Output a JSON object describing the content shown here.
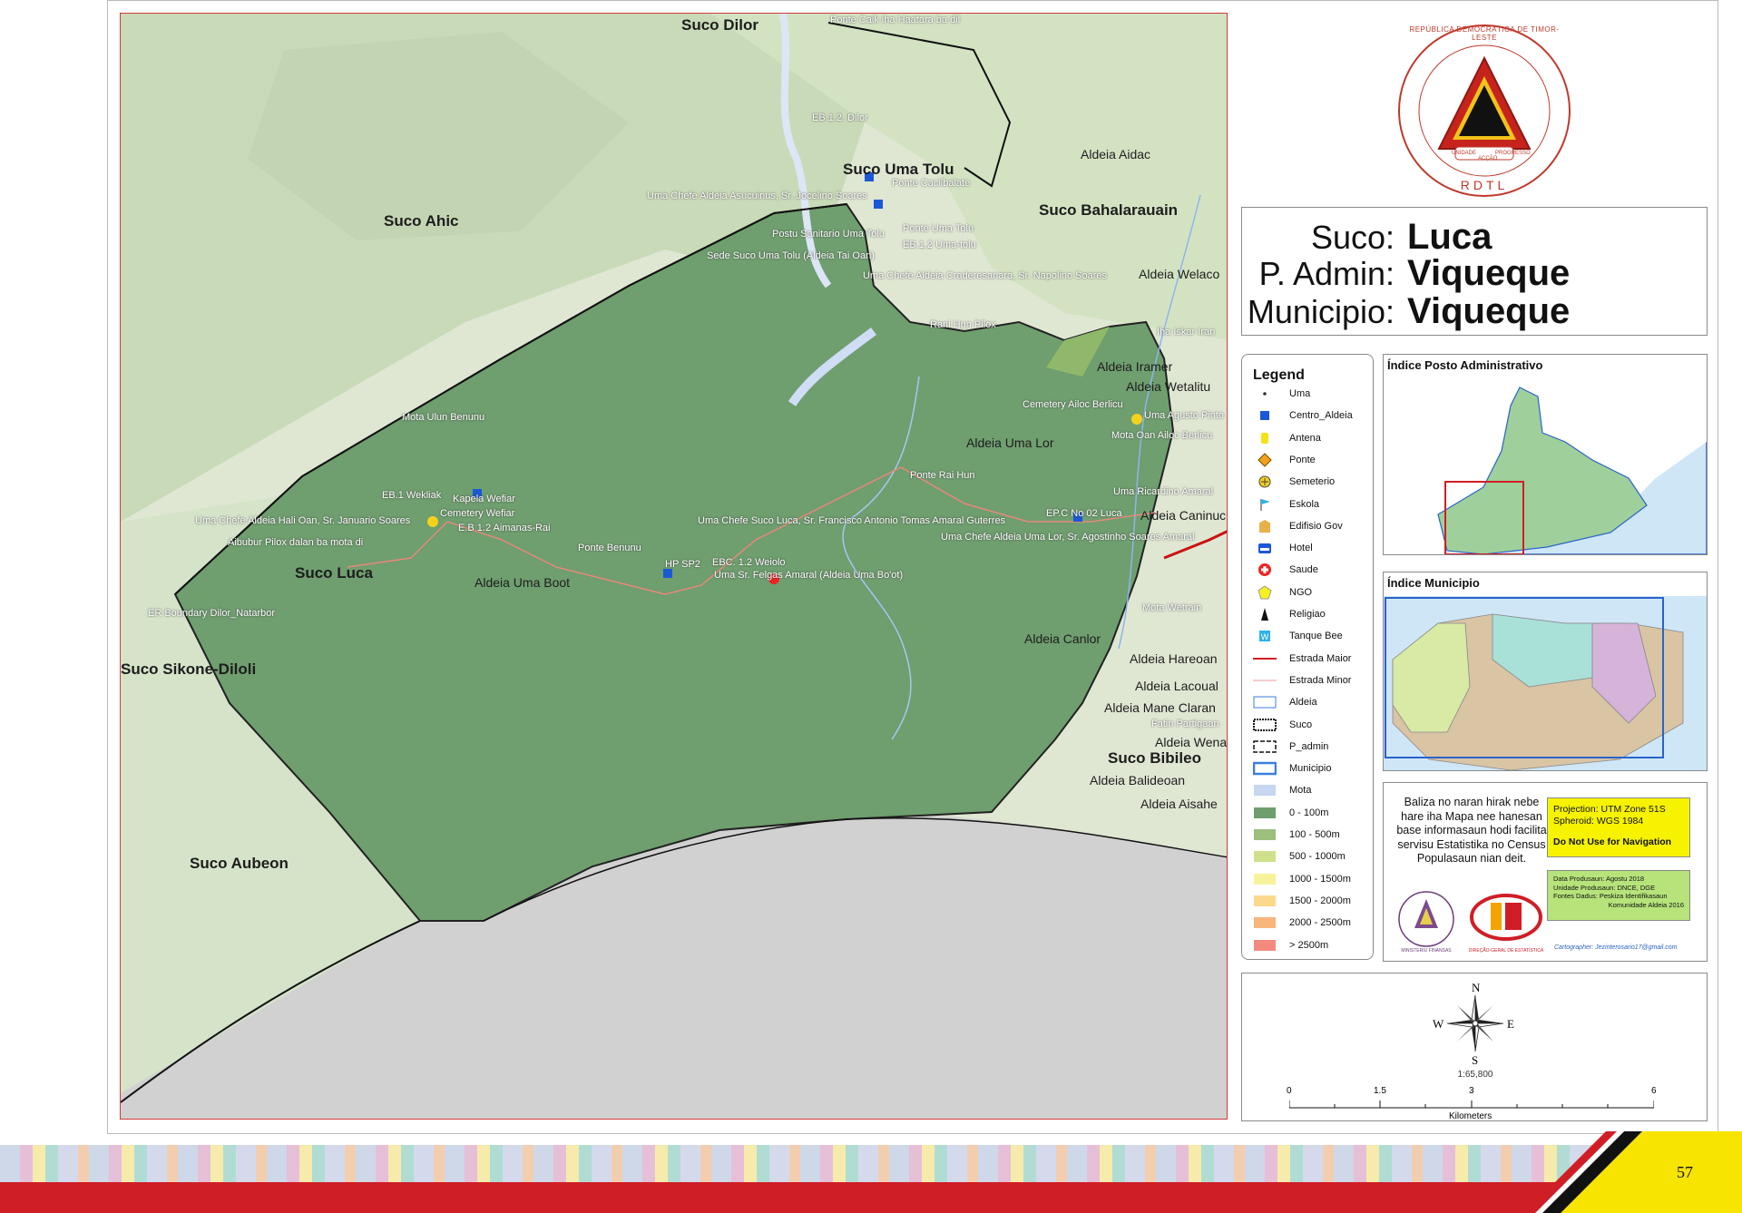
{
  "map": {
    "suco_labels": [
      "Suco Dilor",
      "Suco Uma Tolu",
      "Suco Ahic",
      "Suco Bahalarauain",
      "Suco Luca",
      "Suco Sikone-Diloli",
      "Suco Aubeon",
      "Suco Bibileo"
    ],
    "aldeia_labels": [
      "Aldeia Aidac",
      "Aldeia Welaco",
      "Aldeia Iramer",
      "Aldeia Wetalitu",
      "Aldeia Uma Lor",
      "Aldeia Uma Boot",
      "Aldeia Caninuc",
      "Aldeia Canlor",
      "Aldeia Hareoan",
      "Aldeia Lacoual",
      "Aldeia Mane Claran",
      "Aldeia Wenan",
      "Aldeia Balideoan",
      "Aldeia Aisahe"
    ],
    "feature_labels": [
      "Ponte Caik iha Haatara ba dil",
      "EB.1.2. Dilor",
      "Ponte Cacilbalate",
      "Uma Chefe Aldeia Asucuinus, Sr. Jocelino Soares",
      "Ponte Uma Tolu",
      "Postu Sanitario Uma Tolu",
      "EB.1.2 Uma-tolu",
      "Sede Suco Uma Tolu (Aldeia Tai Oan)",
      "Uma Chefe Aldeia Craderesanara, Sr. Napolino Soares",
      "Rani Hun Pilox",
      "Iha Iskar Iran",
      "Mota Ulun Benunu",
      "Cemetery Ailoc Berlicu",
      "Uma Agusto Pinto",
      "Mota Oan Ailoc Berlicu",
      "Ponte Rai Hun",
      "EB.1 Wekliak",
      "Kapela Wefiar",
      "Cemetery Wefiar",
      "Uma Chefe Aldeia Hali Oan, Sr. Januario Soares",
      "E.B 1.2 Aimanas-Rai",
      "Aibubur Pilox dalan ba mota di",
      "Uma Chefe Suco Luca, Sr. Francisco Antonio Tomas Amaral Guterres",
      "EP.C No 02 Luca",
      "Uma Ricardino Amaral",
      "Uma Chefe Aldeia Uma Lor, Sr. Agostinho Soares Amaral",
      "Ponte Benunu",
      "HP SP2",
      "EBC. 1.2 Weiolo",
      "Uma Sr. Felgas Amaral (Aldeia Uma Bo'ot)",
      "ER Boundary Dilor_Natarbor",
      "Mota Wetrain",
      "Fatin Partigaan"
    ]
  },
  "emblem": {
    "ring_text": "REPÚBLICA DEMOCRÁTICA DE TIMOR-LESTE",
    "base_text": "RDTL",
    "motto": [
      "UNIDADE",
      "ACÇÃO",
      "PROGRESSO"
    ]
  },
  "title": {
    "suco_label": "Suco:",
    "suco_value": "Luca",
    "padmin_label": "P. Admin:",
    "padmin_value": "Viqueque",
    "municipio_label": "Municipio:",
    "municipio_value": "Viqueque"
  },
  "legend": {
    "heading": "Legend",
    "items": [
      {
        "label": "Uma",
        "symbol": "dot"
      },
      {
        "label": "Centro_Aldeia",
        "symbol": "blue-square"
      },
      {
        "label": "Antena",
        "symbol": "antenna"
      },
      {
        "label": "Ponte",
        "symbol": "bridge"
      },
      {
        "label": "Semeterio",
        "symbol": "cemetery"
      },
      {
        "label": "Eskola",
        "symbol": "flag"
      },
      {
        "label": "Edifisio Gov",
        "symbol": "building"
      },
      {
        "label": "Hotel",
        "symbol": "bed"
      },
      {
        "label": "Saude",
        "symbol": "cross"
      },
      {
        "label": "NGO",
        "symbol": "pentagon"
      },
      {
        "label": "Religiao",
        "symbol": "church"
      },
      {
        "label": "Tanque Bee",
        "symbol": "water"
      },
      {
        "label": "Estrada Maior",
        "symbol": "line-red"
      },
      {
        "label": "Estrada Minor",
        "symbol": "line-pink"
      },
      {
        "label": "Aldeia",
        "symbol": "poly-blue"
      },
      {
        "label": "Suco",
        "symbol": "poly-hatch"
      },
      {
        "label": "P_admin",
        "symbol": "poly-dash"
      },
      {
        "label": "Municipio",
        "symbol": "poly-bold-blue"
      },
      {
        "label": "Mota",
        "symbol": "fill-mota"
      },
      {
        "label": "0 - 100m",
        "symbol": "fill-0"
      },
      {
        "label": "100 - 500m",
        "symbol": "fill-1"
      },
      {
        "label": "500 - 1000m",
        "symbol": "fill-2"
      },
      {
        "label": "1000 - 1500m",
        "symbol": "fill-3"
      },
      {
        "label": "1500 - 2000m",
        "symbol": "fill-4"
      },
      {
        "label": "2000 - 2500m",
        "symbol": "fill-5"
      },
      {
        "label": "> 2500m",
        "symbol": "fill-6"
      }
    ],
    "colors": {
      "fill-mota": "#c7d7f2",
      "fill-0": "#6e9e6e",
      "fill-1": "#9cbf7c",
      "fill-2": "#cfe08b",
      "fill-3": "#f6f39c",
      "fill-4": "#fbd98c",
      "fill-5": "#f8b57c",
      "fill-6": "#f28a7e"
    }
  },
  "index_posto": {
    "title": "Índice Posto Administrativo"
  },
  "index_municipio": {
    "title": "Índice Municipio"
  },
  "info": {
    "disclaimer": "Baliza no naran hirak nebe hare iha Mapa nee hanesan base informasaun hodi facilita servisu Estatistika no Census Populasaun nian deit.",
    "projection": "Projection: UTM Zone 51S",
    "spheroid": "Spheroid: WGS 1984",
    "warning": "Do Not Use for Navigation",
    "data_produsaun": "Data Produsaun: Agostu 2018",
    "unidade": "Unidade Produsaun: DNCE, DGE",
    "fontes_line1": "Fontes Dadus: Peskiza Identifikasaun",
    "fontes_line2": "Komunidade Aldeia 2016",
    "logo_left_text": "MINISTERIU FINANSAS",
    "logo_right_text": "DIREÇÃO-GERAL DE ESTATÍSTICA",
    "cartographer": "Cartographer: Jezinterosario17@gmail.com"
  },
  "scale": {
    "compass": {
      "n": "N",
      "s": "S",
      "e": "E",
      "w": "W"
    },
    "ratio": "1:65,800",
    "ticks": [
      "0",
      "1.5",
      "3",
      "6"
    ],
    "unit": "Kilometers"
  },
  "footer": {
    "page_number": "57"
  }
}
